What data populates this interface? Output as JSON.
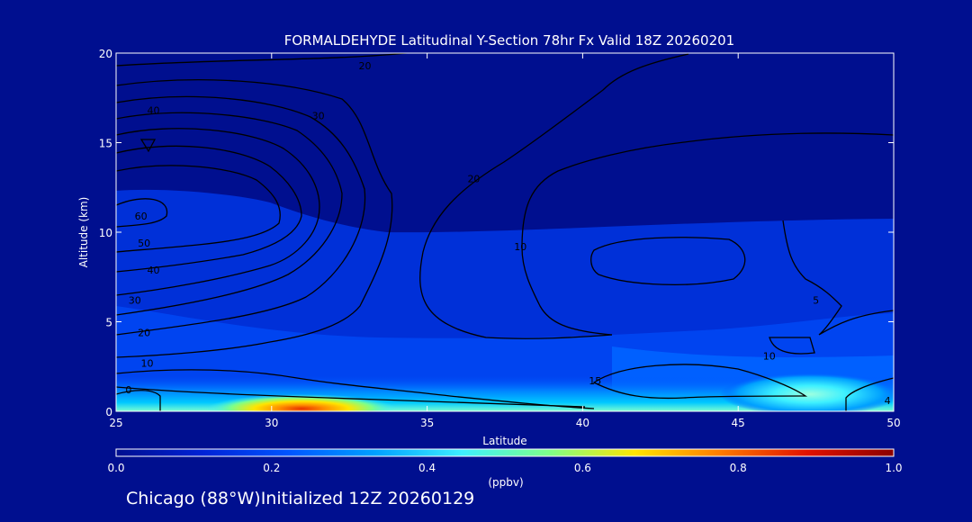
{
  "chart_data": {
    "type": "heatmap",
    "title": "FORMALDEHYDE Latitudinal Y-Section 78hr  Fx Valid 18Z 20260201",
    "xlabel": "Latitude",
    "ylabel": "Altitude (km)",
    "xlim": [
      25,
      50
    ],
    "ylim": [
      0,
      20
    ],
    "x_ticks": [
      25,
      30,
      35,
      40,
      45,
      50
    ],
    "y_ticks": [
      0,
      5,
      10,
      15,
      20
    ],
    "grid": false,
    "colorbar": {
      "label": "(ppbv)",
      "range": [
        0.0,
        1.0
      ],
      "ticks": [
        "0.0",
        "0.2",
        "0.4",
        "0.6",
        "0.8",
        "1.0"
      ],
      "colors": [
        "#000f8f",
        "#0022d6",
        "#0055ff",
        "#00a0ff",
        "#3df0ff",
        "#7dff8a",
        "#ffe500",
        "#ff7a00",
        "#e01000",
        "#8a0000"
      ]
    },
    "contour_labels": [
      {
        "text": "20",
        "lat": 33.0,
        "alt": 19.3
      },
      {
        "text": "30",
        "lat": 31.5,
        "alt": 16.5
      },
      {
        "text": "40",
        "lat": 26.2,
        "alt": 16.8
      },
      {
        "text": "60",
        "lat": 25.8,
        "alt": 10.9
      },
      {
        "text": "50",
        "lat": 25.9,
        "alt": 9.4
      },
      {
        "text": "40",
        "lat": 26.2,
        "alt": 7.9
      },
      {
        "text": "30",
        "lat": 25.6,
        "alt": 6.2
      },
      {
        "text": "20",
        "lat": 25.9,
        "alt": 4.4
      },
      {
        "text": "10",
        "lat": 26.0,
        "alt": 2.7
      },
      {
        "text": "0",
        "lat": 25.4,
        "alt": 1.2
      },
      {
        "text": "20",
        "lat": 36.5,
        "alt": 13.0
      },
      {
        "text": "10",
        "lat": 38.0,
        "alt": 9.2
      },
      {
        "text": "5",
        "lat": 47.5,
        "alt": 6.2
      },
      {
        "text": "10",
        "lat": 46.0,
        "alt": 3.1
      },
      {
        "text": "15",
        "lat": 40.4,
        "alt": 1.7
      },
      {
        "text": "4",
        "lat": 49.8,
        "alt": 0.6
      }
    ]
  },
  "footer": {
    "init_text": "Chicago (88°W)Initialized 12Z 20260129"
  }
}
